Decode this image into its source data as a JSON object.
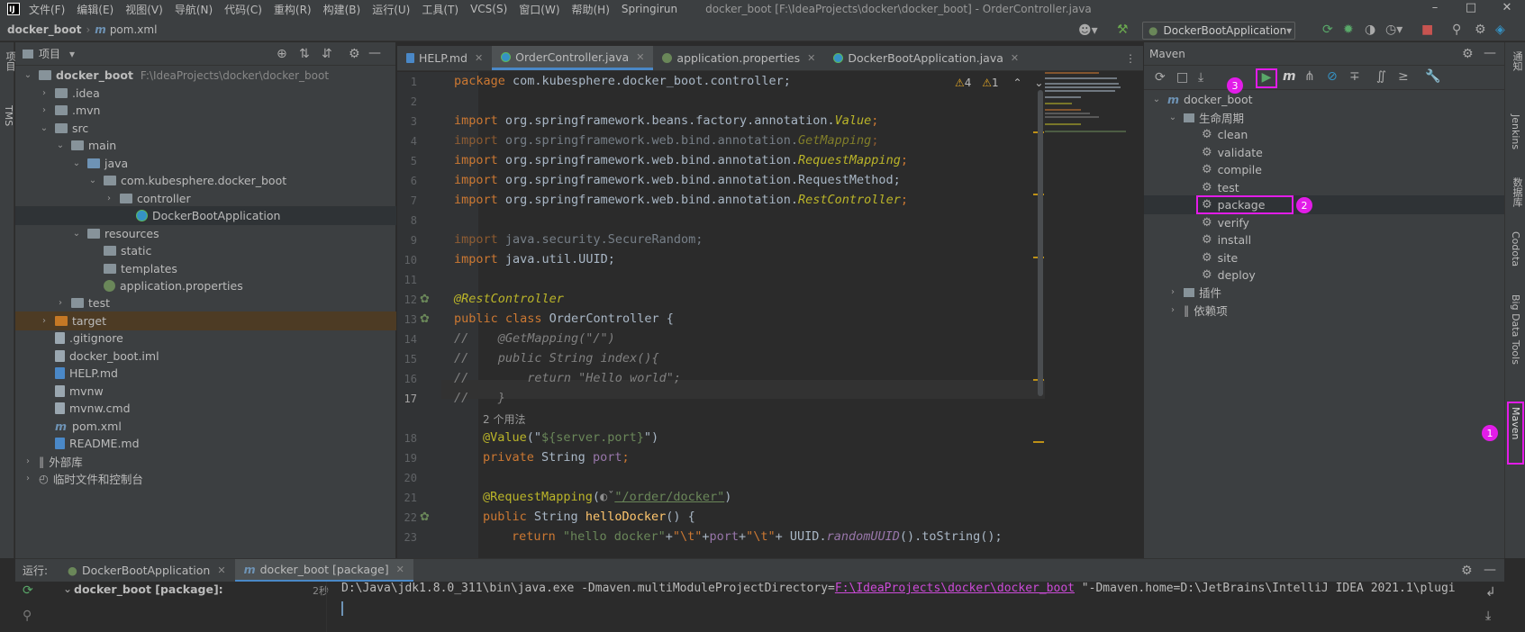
{
  "menubar": {
    "items": [
      "文件(F)",
      "编辑(E)",
      "视图(V)",
      "导航(N)",
      "代码(C)",
      "重构(R)",
      "构建(B)",
      "运行(U)",
      "工具(T)",
      "VCS(S)",
      "窗口(W)",
      "帮助(H)",
      "Springirun"
    ],
    "window_title": "docker_boot [F:\\IdeaProjects\\docker\\docker_boot] - OrderController.java"
  },
  "navbar": {
    "crumbs": [
      "docker_boot",
      "pom.xml"
    ],
    "run_config": "DockerBootApplication"
  },
  "left_stripe": {
    "labels": [
      "项目",
      "TMS"
    ]
  },
  "right_stripe": {
    "labels": [
      "通知",
      "Jenkins",
      "数据库",
      "Codota",
      "Big Data Tools",
      "Maven"
    ]
  },
  "project_panel": {
    "title": "项目",
    "tree": [
      {
        "label": "docker_boot",
        "extra": "F:\\IdeaProjects\\docker\\docker_boot"
      },
      {
        "label": ".idea"
      },
      {
        "label": ".mvn"
      },
      {
        "label": "src"
      },
      {
        "label": "main"
      },
      {
        "label": "java"
      },
      {
        "label": "com.kubesphere.docker_boot"
      },
      {
        "label": "controller"
      },
      {
        "label": "DockerBootApplication"
      },
      {
        "label": "resources"
      },
      {
        "label": "static"
      },
      {
        "label": "templates"
      },
      {
        "label": "application.properties"
      },
      {
        "label": "test"
      },
      {
        "label": "target"
      },
      {
        "label": ".gitignore"
      },
      {
        "label": "docker_boot.iml"
      },
      {
        "label": "HELP.md"
      },
      {
        "label": "mvnw"
      },
      {
        "label": "mvnw.cmd"
      },
      {
        "label": "pom.xml"
      },
      {
        "label": "README.md"
      },
      {
        "label": "外部库"
      },
      {
        "label": "临时文件和控制台"
      }
    ]
  },
  "editor": {
    "tabs": [
      "HELP.md",
      "OrderController.java",
      "application.properties",
      "DockerBootApplication.java"
    ],
    "warnings": "4",
    "weak_warnings": "1",
    "usage_hint": "2 个用法",
    "line_numbers": [
      "1",
      "2",
      "3",
      "4",
      "5",
      "6",
      "7",
      "8",
      "9",
      "10",
      "11",
      "12",
      "13",
      "14",
      "15",
      "16",
      "17",
      "18",
      "19",
      "20",
      "21",
      "22",
      "23"
    ],
    "code": {
      "l1_kw": "package",
      "l1": " com.kubesphere.docker_boot.controller;",
      "import": "import",
      "l3": " org.springframework.beans.factory.annotation.",
      "l3_cls": "Value",
      "semi": ";",
      "l4": " org.springframework.web.bind.annotation.",
      "l4_cls": "GetMapping",
      "l5": " org.springframework.web.bind.annotation.",
      "l5_cls": "RequestMapping",
      "l6": " org.springframework.web.bind.annotation.RequestMethod;",
      "l7": " org.springframework.web.bind.annotation.",
      "l7_cls": "RestController",
      "l9": " java.security.SecureRandom;",
      "l10": " java.util.UUID;",
      "l12": "@RestController",
      "l13_kw": "public class",
      "l13": " OrderController {",
      "l14": "//    @GetMapping(\"/\")",
      "l15": "//    public String index(){",
      "l16": "//        return \"Hello world\";",
      "l17": "//    }",
      "l18_ann": "@Value",
      "l18_a": "(\"",
      "l18_s": "${server.port}",
      "l18_b": "\")",
      "l19_kw": "private",
      "l19_a": " String ",
      "l19_f": "port",
      "l19_b": ";",
      "l21_ann": "@RequestMapping",
      "l21_a": "(",
      "l21_s": "\"/order/docker\"",
      "l21_b": ")",
      "l22_kw": "public",
      "l22_a": " String ",
      "l22_m": "helloDocker",
      "l22_b": "() {",
      "l23_kw": "return",
      "l23_s1": " \"hello docker\"",
      "l23_p1": "+",
      "l23_s2": "\"\\t\"",
      "l23_p2": "+",
      "l23_f": "port",
      "l23_p3": "+",
      "l23_s3": "\"\\t\"",
      "l23_p4": "+ UUID.",
      "l23_m": "randomUUID",
      "l23_end": "().toString();"
    }
  },
  "maven": {
    "title": "Maven",
    "tree": {
      "root": "docker_boot",
      "lifecycle": "生命周期",
      "phases": [
        "clean",
        "validate",
        "compile",
        "test",
        "package",
        "verify",
        "install",
        "site",
        "deploy"
      ],
      "plugins": "插件",
      "deps": "依赖项"
    },
    "badges": [
      "1",
      "2",
      "3"
    ]
  },
  "run_bar": {
    "label": "运行:",
    "tabs": [
      "DockerBootApplication",
      "docker_boot [package]"
    ]
  },
  "console": {
    "task": "docker_boot [package]:",
    "time": "2秒",
    "cmd_prefix": "D:\\Java\\jdk1.8.0_311\\bin\\java.exe -Dmaven.multiModuleProjectDirectory=",
    "cmd_link": "F:\\IdeaProjects\\docker\\docker_boot",
    "cmd_suffix": " \"-Dmaven.home=D:\\JetBrains\\IntelliJ IDEA 2021.1\\plugi"
  },
  "colors": {
    "highlight": "#e21ce8",
    "accent": "#4a88c7"
  }
}
